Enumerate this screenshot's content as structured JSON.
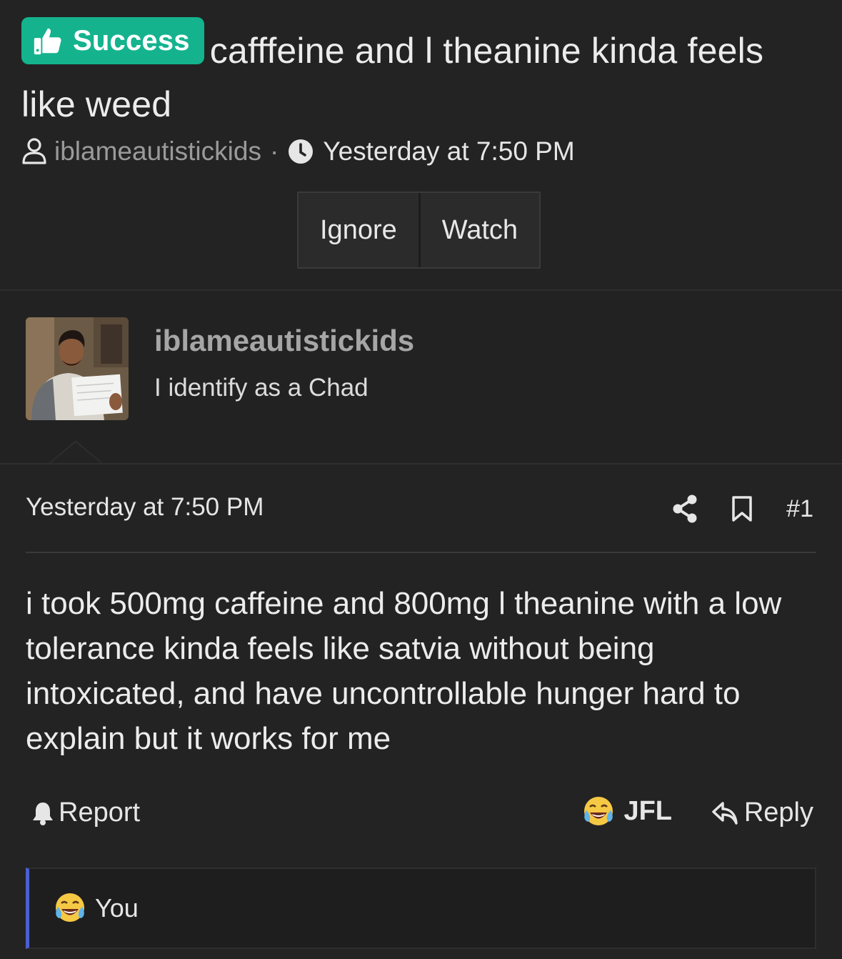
{
  "thread": {
    "prefix_label": "Success",
    "prefix_color": "#14b38e",
    "title": "cafffeine and l theanine kinda feels like weed",
    "author": "iblameautistickids",
    "separator": "·",
    "time": "Yesterday at 7:50 PM",
    "buttons": {
      "ignore": "Ignore",
      "watch": "Watch"
    }
  },
  "user": {
    "name": "iblameautistickids",
    "title": "I identify as a Chad"
  },
  "post": {
    "time": "Yesterday at 7:50 PM",
    "number": "#1",
    "body": "i took 500mg caffeine and 800mg l theanine with a low tolerance kinda feels like satvia without being intoxicated, and have uncontrollable hunger hard to explain but it works for me",
    "actions": {
      "report": "Report",
      "reaction": "JFL",
      "reply": "Reply"
    },
    "reactions_summary": "You",
    "accent_color": "#4b5fd2"
  },
  "icons": {
    "prefix": "thumbs-up-icon",
    "author": "user-icon",
    "time": "clock-icon",
    "share": "share-icon",
    "bookmark": "bookmark-icon",
    "report": "bell-icon",
    "reaction": "laughing-crying-emoji-icon",
    "reply": "reply-arrow-icon"
  }
}
